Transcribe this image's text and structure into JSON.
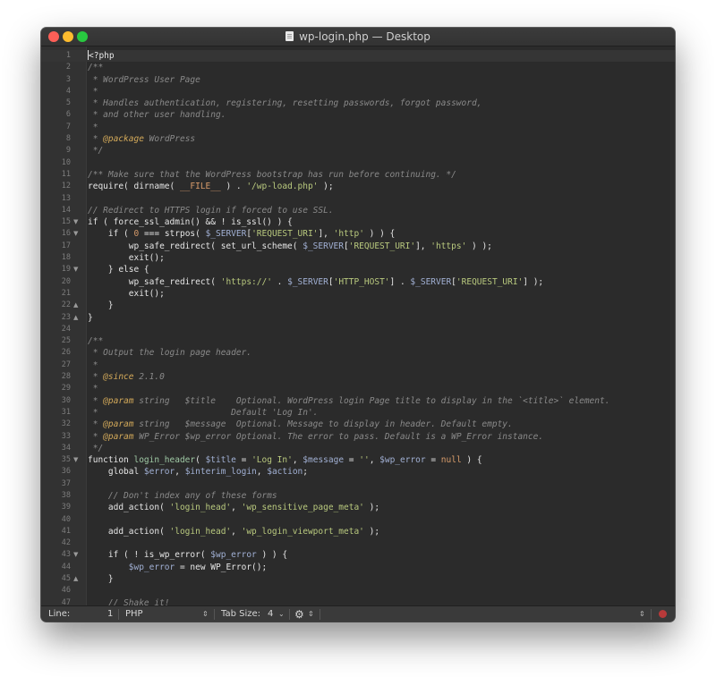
{
  "window": {
    "title": "wp-login.php — Desktop"
  },
  "editor": {
    "current_line": "1",
    "lines": [
      {
        "n": "1",
        "fold": "",
        "spans": [
          {
            "t": "<?php",
            "c": "plain"
          }
        ]
      },
      {
        "n": "2",
        "fold": "",
        "spans": [
          {
            "t": "/**",
            "c": "comment"
          }
        ]
      },
      {
        "n": "3",
        "fold": "",
        "spans": [
          {
            "t": " * WordPress User Page",
            "c": "comment"
          }
        ]
      },
      {
        "n": "4",
        "fold": "",
        "spans": [
          {
            "t": " *",
            "c": "comment"
          }
        ]
      },
      {
        "n": "5",
        "fold": "",
        "spans": [
          {
            "t": " * Handles authentication, registering, resetting passwords, forgot password,",
            "c": "comment"
          }
        ]
      },
      {
        "n": "6",
        "fold": "",
        "spans": [
          {
            "t": " * and other user handling.",
            "c": "comment"
          }
        ]
      },
      {
        "n": "7",
        "fold": "",
        "spans": [
          {
            "t": " *",
            "c": "comment"
          }
        ]
      },
      {
        "n": "8",
        "fold": "",
        "spans": [
          {
            "t": " * ",
            "c": "comment"
          },
          {
            "t": "@package",
            "c": "tag"
          },
          {
            "t": " WordPress",
            "c": "comment"
          }
        ]
      },
      {
        "n": "9",
        "fold": "",
        "spans": [
          {
            "t": " */",
            "c": "comment"
          }
        ]
      },
      {
        "n": "10",
        "fold": "",
        "spans": []
      },
      {
        "n": "11",
        "fold": "",
        "spans": [
          {
            "t": "/** Make sure that the WordPress bootstrap has run before continuing. */",
            "c": "comment"
          }
        ]
      },
      {
        "n": "12",
        "fold": "",
        "spans": [
          {
            "t": "require( dirname( ",
            "c": "plain"
          },
          {
            "t": "__FILE__",
            "c": "const"
          },
          {
            "t": " ) . ",
            "c": "plain"
          },
          {
            "t": "'/wp-load.php'",
            "c": "str"
          },
          {
            "t": " );",
            "c": "plain"
          }
        ]
      },
      {
        "n": "13",
        "fold": "",
        "spans": []
      },
      {
        "n": "14",
        "fold": "",
        "spans": [
          {
            "t": "// Redirect to HTTPS login if forced to use SSL.",
            "c": "comment"
          }
        ]
      },
      {
        "n": "15",
        "fold": "down",
        "spans": [
          {
            "t": "if ( force_ssl_admin() && ! is_ssl() ) {",
            "c": "plain"
          }
        ]
      },
      {
        "n": "16",
        "fold": "down",
        "spans": [
          {
            "t": "    if ( ",
            "c": "plain"
          },
          {
            "t": "0",
            "c": "const"
          },
          {
            "t": " === strpos( ",
            "c": "plain"
          },
          {
            "t": "$_SERVER",
            "c": "var"
          },
          {
            "t": "[",
            "c": "plain"
          },
          {
            "t": "'REQUEST_URI'",
            "c": "str"
          },
          {
            "t": "], ",
            "c": "plain"
          },
          {
            "t": "'http'",
            "c": "str"
          },
          {
            "t": " ) ) {",
            "c": "plain"
          }
        ]
      },
      {
        "n": "17",
        "fold": "",
        "spans": [
          {
            "t": "        wp_safe_redirect( set_url_scheme( ",
            "c": "plain"
          },
          {
            "t": "$_SERVER",
            "c": "var"
          },
          {
            "t": "[",
            "c": "plain"
          },
          {
            "t": "'REQUEST_URI'",
            "c": "str"
          },
          {
            "t": "], ",
            "c": "plain"
          },
          {
            "t": "'https'",
            "c": "str"
          },
          {
            "t": " ) );",
            "c": "plain"
          }
        ]
      },
      {
        "n": "18",
        "fold": "",
        "spans": [
          {
            "t": "        exit();",
            "c": "plain"
          }
        ]
      },
      {
        "n": "19",
        "fold": "down",
        "spans": [
          {
            "t": "    } else {",
            "c": "plain"
          }
        ]
      },
      {
        "n": "20",
        "fold": "",
        "spans": [
          {
            "t": "        wp_safe_redirect( ",
            "c": "plain"
          },
          {
            "t": "'https://'",
            "c": "str"
          },
          {
            "t": " . ",
            "c": "plain"
          },
          {
            "t": "$_SERVER",
            "c": "var"
          },
          {
            "t": "[",
            "c": "plain"
          },
          {
            "t": "'HTTP_HOST'",
            "c": "str"
          },
          {
            "t": "] . ",
            "c": "plain"
          },
          {
            "t": "$_SERVER",
            "c": "var"
          },
          {
            "t": "[",
            "c": "plain"
          },
          {
            "t": "'REQUEST_URI'",
            "c": "str"
          },
          {
            "t": "] );",
            "c": "plain"
          }
        ]
      },
      {
        "n": "21",
        "fold": "",
        "spans": [
          {
            "t": "        exit();",
            "c": "plain"
          }
        ]
      },
      {
        "n": "22",
        "fold": "up",
        "spans": [
          {
            "t": "    }",
            "c": "plain"
          }
        ]
      },
      {
        "n": "23",
        "fold": "up",
        "spans": [
          {
            "t": "}",
            "c": "plain"
          }
        ]
      },
      {
        "n": "24",
        "fold": "",
        "spans": []
      },
      {
        "n": "25",
        "fold": "",
        "spans": [
          {
            "t": "/**",
            "c": "comment"
          }
        ]
      },
      {
        "n": "26",
        "fold": "",
        "spans": [
          {
            "t": " * Output the login page header.",
            "c": "comment"
          }
        ]
      },
      {
        "n": "27",
        "fold": "",
        "spans": [
          {
            "t": " *",
            "c": "comment"
          }
        ]
      },
      {
        "n": "28",
        "fold": "",
        "spans": [
          {
            "t": " * ",
            "c": "comment"
          },
          {
            "t": "@since",
            "c": "tag"
          },
          {
            "t": " 2.1.0",
            "c": "comment"
          }
        ]
      },
      {
        "n": "29",
        "fold": "",
        "spans": [
          {
            "t": " *",
            "c": "comment"
          }
        ]
      },
      {
        "n": "30",
        "fold": "",
        "spans": [
          {
            "t": " * ",
            "c": "comment"
          },
          {
            "t": "@param",
            "c": "tag"
          },
          {
            "t": " string   $title    Optional. WordPress login Page title to display in the `<title>` element.",
            "c": "comment"
          }
        ]
      },
      {
        "n": "31",
        "fold": "",
        "spans": [
          {
            "t": " *                          Default 'Log In'.",
            "c": "comment"
          }
        ]
      },
      {
        "n": "32",
        "fold": "",
        "spans": [
          {
            "t": " * ",
            "c": "comment"
          },
          {
            "t": "@param",
            "c": "tag"
          },
          {
            "t": " string   $message  Optional. Message to display in header. Default empty.",
            "c": "comment"
          }
        ]
      },
      {
        "n": "33",
        "fold": "",
        "spans": [
          {
            "t": " * ",
            "c": "comment"
          },
          {
            "t": "@param",
            "c": "tag"
          },
          {
            "t": " WP_Error $wp_error Optional. The error to pass. Default is a WP_Error instance.",
            "c": "comment"
          }
        ]
      },
      {
        "n": "34",
        "fold": "",
        "spans": [
          {
            "t": " */",
            "c": "comment"
          }
        ]
      },
      {
        "n": "35",
        "fold": "down",
        "spans": [
          {
            "t": "function ",
            "c": "plain"
          },
          {
            "t": "login_header",
            "c": "fn"
          },
          {
            "t": "( ",
            "c": "plain"
          },
          {
            "t": "$title",
            "c": "var"
          },
          {
            "t": " = ",
            "c": "plain"
          },
          {
            "t": "'Log In'",
            "c": "str"
          },
          {
            "t": ", ",
            "c": "plain"
          },
          {
            "t": "$message",
            "c": "var"
          },
          {
            "t": " = ",
            "c": "plain"
          },
          {
            "t": "''",
            "c": "str"
          },
          {
            "t": ", ",
            "c": "plain"
          },
          {
            "t": "$wp_error",
            "c": "var"
          },
          {
            "t": " = ",
            "c": "plain"
          },
          {
            "t": "null",
            "c": "const"
          },
          {
            "t": " ) {",
            "c": "plain"
          }
        ]
      },
      {
        "n": "36",
        "fold": "",
        "spans": [
          {
            "t": "    global ",
            "c": "plain"
          },
          {
            "t": "$error",
            "c": "var"
          },
          {
            "t": ", ",
            "c": "plain"
          },
          {
            "t": "$interim_login",
            "c": "var"
          },
          {
            "t": ", ",
            "c": "plain"
          },
          {
            "t": "$action",
            "c": "var"
          },
          {
            "t": ";",
            "c": "plain"
          }
        ]
      },
      {
        "n": "37",
        "fold": "",
        "spans": []
      },
      {
        "n": "38",
        "fold": "",
        "spans": [
          {
            "t": "    // Don't index any of these forms",
            "c": "comment"
          }
        ]
      },
      {
        "n": "39",
        "fold": "",
        "spans": [
          {
            "t": "    add_action( ",
            "c": "plain"
          },
          {
            "t": "'login_head'",
            "c": "str"
          },
          {
            "t": ", ",
            "c": "plain"
          },
          {
            "t": "'wp_sensitive_page_meta'",
            "c": "str"
          },
          {
            "t": " );",
            "c": "plain"
          }
        ]
      },
      {
        "n": "40",
        "fold": "",
        "spans": []
      },
      {
        "n": "41",
        "fold": "",
        "spans": [
          {
            "t": "    add_action( ",
            "c": "plain"
          },
          {
            "t": "'login_head'",
            "c": "str"
          },
          {
            "t": ", ",
            "c": "plain"
          },
          {
            "t": "'wp_login_viewport_meta'",
            "c": "str"
          },
          {
            "t": " );",
            "c": "plain"
          }
        ]
      },
      {
        "n": "42",
        "fold": "",
        "spans": []
      },
      {
        "n": "43",
        "fold": "down",
        "spans": [
          {
            "t": "    if ( ! is_wp_error( ",
            "c": "plain"
          },
          {
            "t": "$wp_error",
            "c": "var"
          },
          {
            "t": " ) ) {",
            "c": "plain"
          }
        ]
      },
      {
        "n": "44",
        "fold": "",
        "spans": [
          {
            "t": "        ",
            "c": "plain"
          },
          {
            "t": "$wp_error",
            "c": "var"
          },
          {
            "t": " = new WP_Error();",
            "c": "plain"
          }
        ]
      },
      {
        "n": "45",
        "fold": "up",
        "spans": [
          {
            "t": "    }",
            "c": "plain"
          }
        ]
      },
      {
        "n": "46",
        "fold": "",
        "spans": []
      },
      {
        "n": "47",
        "fold": "",
        "spans": [
          {
            "t": "    // Shake it!",
            "c": "comment"
          }
        ]
      }
    ]
  },
  "statusbar": {
    "line_label": "Line:",
    "line_value": "1",
    "language": "PHP",
    "tab_size_label": "Tab Size:",
    "tab_size_value": "4"
  }
}
